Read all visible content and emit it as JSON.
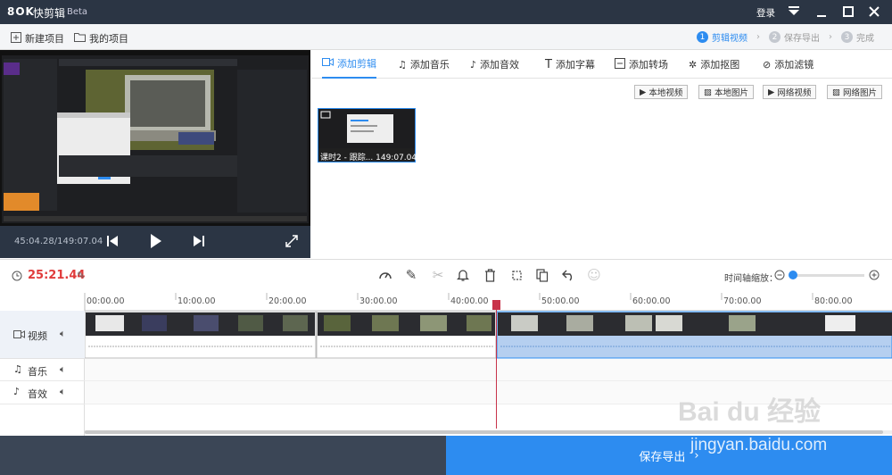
{
  "app": {
    "logo": "8OK",
    "name": "快剪辑",
    "edition": "Beta",
    "login": "登录"
  },
  "menubar": {
    "new_project": "新建项目",
    "my_project": "我的项目"
  },
  "steps": [
    {
      "num": "1",
      "label": "剪辑视频"
    },
    {
      "num": "2",
      "label": "保存导出"
    },
    {
      "num": "3",
      "label": "完成"
    }
  ],
  "preview": {
    "time_current": "45:04.28",
    "time_total": "149:07.04",
    "time_display": "45:04.28/149:07.04"
  },
  "tabs": [
    {
      "label": "添加剪辑"
    },
    {
      "label": "添加音乐"
    },
    {
      "label": "添加音效"
    },
    {
      "label": "添加字幕"
    },
    {
      "label": "添加转场"
    },
    {
      "label": "添加抠图"
    },
    {
      "label": "添加滤镜"
    }
  ],
  "source_buttons": [
    {
      "label": "本地视频"
    },
    {
      "label": "本地图片"
    },
    {
      "label": "网络视频"
    },
    {
      "label": "网络图片"
    }
  ],
  "media_clip": {
    "caption": "课时2 - 跟踪... 149:07.04"
  },
  "timeline": {
    "position": "25:21.44",
    "zoom_label": "时间轴缩放："
  },
  "ruler_ticks": [
    "00:00.00",
    "10:00.00",
    "20:00.00",
    "30:00.00",
    "40:00.00",
    "50:00.00",
    "60:00.00",
    "70:00.00",
    "80:00.00"
  ],
  "tracks": [
    {
      "label": "视频"
    },
    {
      "label": "音乐"
    },
    {
      "label": "音效"
    }
  ],
  "bottom": {
    "save_label": "保存导出"
  },
  "watermark": {
    "brand": "Bai du 经验",
    "url": "jingyan.baidu.com"
  },
  "colors": {
    "accent": "#2d8cf0",
    "time_red": "#e03b3b",
    "titlebar": "#2b3544"
  }
}
